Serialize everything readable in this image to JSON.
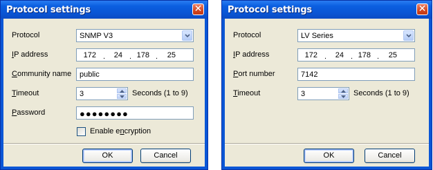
{
  "dialogs": [
    {
      "title": "Protocol settings",
      "close_glyph": "✕",
      "protocol": {
        "label_pre": "",
        "label_ul": "",
        "label_post": "Protocol",
        "value": "SNMP V3"
      },
      "ip": {
        "label_ul": "I",
        "label_post": "P address",
        "octets": [
          "172",
          "24",
          "178",
          "25"
        ]
      },
      "field3": {
        "label_ul": "C",
        "label_post": "ommunity name",
        "value": "public"
      },
      "timeout": {
        "label_ul": "T",
        "label_post": "imeout",
        "value": "3",
        "hint": "Seconds (1 to 9)"
      },
      "password": {
        "label_ul": "P",
        "label_post": "assword",
        "value": "●●●●●●●●"
      },
      "encryption": {
        "label_pre": "Enable e",
        "label_ul": "n",
        "label_post": "cryption",
        "checked": false
      },
      "ok_label": "OK",
      "cancel_label": "Cancel"
    },
    {
      "title": "Protocol settings",
      "close_glyph": "✕",
      "protocol": {
        "label_pre": "",
        "label_ul": "",
        "label_post": "Protocol",
        "value": "LV Series"
      },
      "ip": {
        "label_ul": "I",
        "label_post": "P address",
        "octets": [
          "172",
          "24",
          "178",
          "25"
        ]
      },
      "field3": {
        "label_ul": "P",
        "label_post": "ort number",
        "value": "7142"
      },
      "timeout": {
        "label_ul": "T",
        "label_post": "imeout",
        "value": "3",
        "hint": "Seconds (1 to 9)"
      },
      "ok_label": "OK",
      "cancel_label": "Cancel"
    }
  ],
  "colors": {
    "title_bar": "#0a55d4",
    "client": "#ece9d8",
    "close_button": "#d3461f",
    "field_border": "#7f9db9"
  }
}
